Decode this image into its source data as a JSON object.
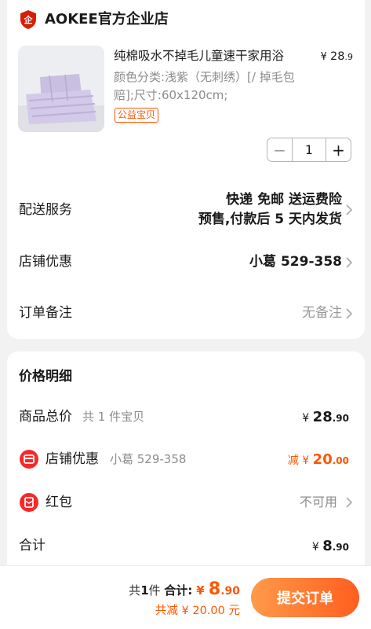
{
  "shop": {
    "name": "AOKEE官方企业店",
    "logo_icon": "shield-logo-icon"
  },
  "product": {
    "title": "纯棉吸水不掉毛儿童速干家用浴",
    "price_currency": "¥",
    "price_main": "28",
    "price_cents": ".9",
    "sku": "颜色分类:浅紫（无刺绣）[/ 掉毛包赔];尺寸:60x120cm;",
    "tag": "公益宝贝",
    "quantity": "1",
    "minus": "−",
    "plus": "+"
  },
  "delivery": {
    "label": "配送服务",
    "line1": "快递 免邮 送运费险",
    "line2": "预售,付款后 5 天内发货"
  },
  "shop_coupon": {
    "label": "店铺优惠",
    "value": "小葛 529-358"
  },
  "order_note": {
    "label": "订单备注",
    "value": "无备注"
  },
  "price_detail": {
    "title": "价格明细",
    "goods_total": {
      "label": "商品总价",
      "sub": "共 1 件宝贝",
      "yen": "¥",
      "main": "28",
      "cents": ".90"
    },
    "shop_discount": {
      "label": "店铺优惠",
      "sub": "小葛 529-358",
      "prefix": "减 ¥",
      "main": "20",
      "cents": ".00"
    },
    "red_packet": {
      "label": "红包",
      "value": "不可用"
    },
    "total": {
      "label": "合计",
      "yen": "¥",
      "main": "8",
      "cents": ".90"
    }
  },
  "bottom_bar": {
    "count_prefix": "共",
    "count": "1",
    "count_suffix": "件",
    "total_label": "合计:",
    "yen": "¥",
    "main": "8",
    "cents": ".90",
    "discount_text": "共减 ¥ 20.00 元",
    "submit_label": "提交订单"
  },
  "colors": {
    "accent": "#ff5500",
    "button_start": "#ff9a4a",
    "button_end": "#ff5e1f",
    "icon_red": "#f42a2a"
  }
}
